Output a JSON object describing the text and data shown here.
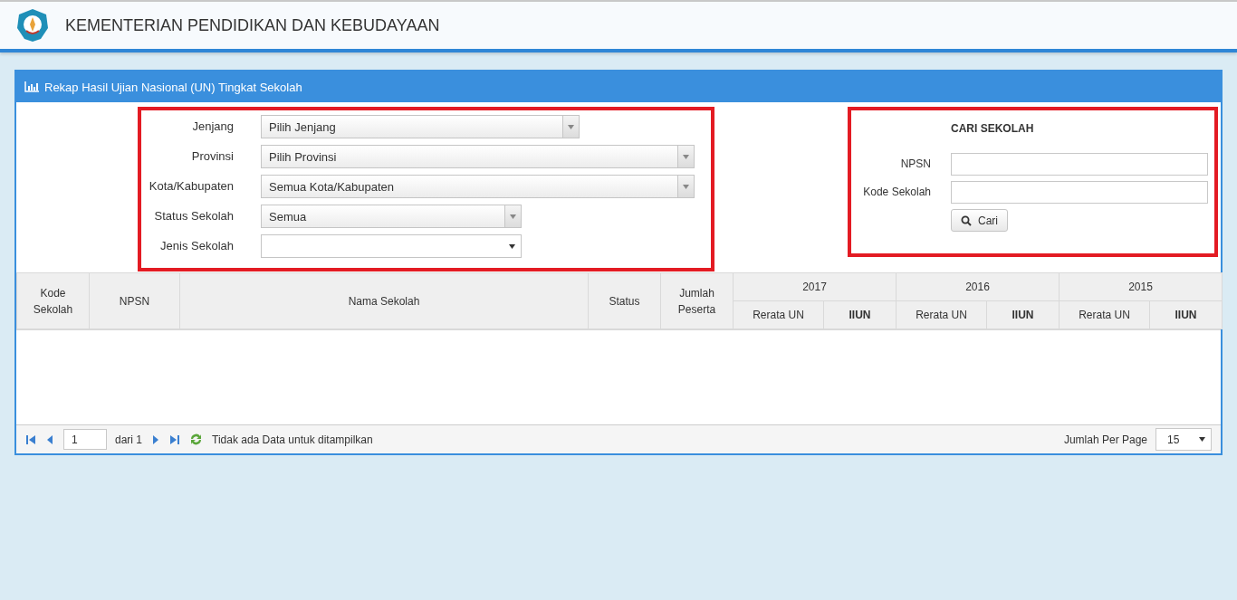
{
  "header": {
    "title": "KEMENTERIAN PENDIDIKAN DAN KEBUDAYAAN"
  },
  "panel": {
    "title": "Rekap Hasil Ujian Nasional (UN) Tingkat Sekolah"
  },
  "filters": [
    {
      "label": "Jenjang",
      "value": "Pilih Jenjang",
      "kind": "combo"
    },
    {
      "label": "Provinsi",
      "value": "Pilih Provinsi",
      "kind": "combo"
    },
    {
      "label": "Kota/Kabupaten",
      "value": "Semua Kota/Kabupaten",
      "kind": "combo"
    },
    {
      "label": "Status Sekolah",
      "value": "Semua",
      "kind": "combo"
    },
    {
      "label": "Jenis Sekolah",
      "kind": "select"
    }
  ],
  "search": {
    "title": "CARI SEKOLAH",
    "fields": [
      {
        "label": "NPSN"
      },
      {
        "label": "Kode Sekolah"
      }
    ],
    "button": "Cari"
  },
  "table": {
    "columns": [
      "Kode Sekolah",
      "NPSN",
      "Nama Sekolah",
      "Status",
      "Jumlah Peserta"
    ],
    "year_groups": [
      {
        "year": "2017",
        "columns": [
          {
            "label": "Rerata UN",
            "bold": false
          },
          {
            "label": "IIUN",
            "bold": true
          }
        ]
      },
      {
        "year": "2016",
        "columns": [
          {
            "label": "Rerata UN",
            "bold": false
          },
          {
            "label": "IIUN",
            "bold": true
          }
        ]
      },
      {
        "year": "2015",
        "columns": [
          {
            "label": "Rerata UN",
            "bold": false
          },
          {
            "label": "IIUN",
            "bold": true
          }
        ]
      }
    ]
  },
  "pager": {
    "page": "1",
    "of": "dari 1",
    "message": "Tidak ada Data untuk ditampilkan",
    "per_page_label": "Jumlah Per Page",
    "per_page": "15"
  }
}
